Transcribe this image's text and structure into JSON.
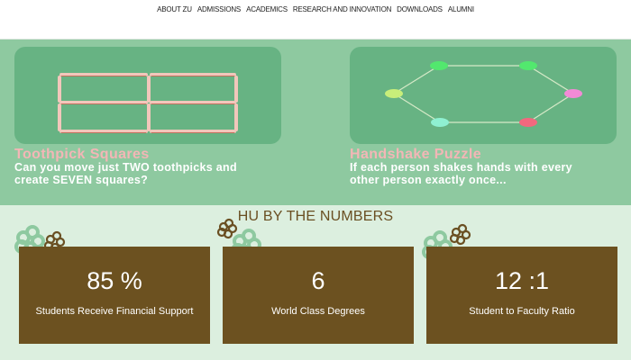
{
  "nav": {
    "items": [
      "ABOUT ZU",
      "ADMISSIONS",
      "ACADEMICS",
      "RESEARCH AND INNOVATION",
      "DOWNLOADS",
      "ALUMNI"
    ]
  },
  "puzzles": [
    {
      "title": "Toothpick Squares",
      "description": "Can you move just TWO toothpicks and create SEVEN squares?"
    },
    {
      "title": "Handshake Puzzle",
      "description": "If each person shakes hands with every other person exactly once..."
    }
  ],
  "numbers": {
    "heading": "HU BY THE NUMBERS",
    "stats": [
      {
        "value": "85 %",
        "label": "Students Receive Financial Support"
      },
      {
        "value": "6",
        "label": "World Class Degrees"
      },
      {
        "value": "12 :1",
        "label": "Student to Faculty Ratio"
      }
    ]
  },
  "colors": {
    "nav_bg": "#ffffff",
    "puzzle_band": "#8ec9a0",
    "puzzle_card": "#67b383",
    "stat_box": "#6c5120",
    "heading": "#6a4f22",
    "puzzle_title": "#f3b6b6"
  }
}
